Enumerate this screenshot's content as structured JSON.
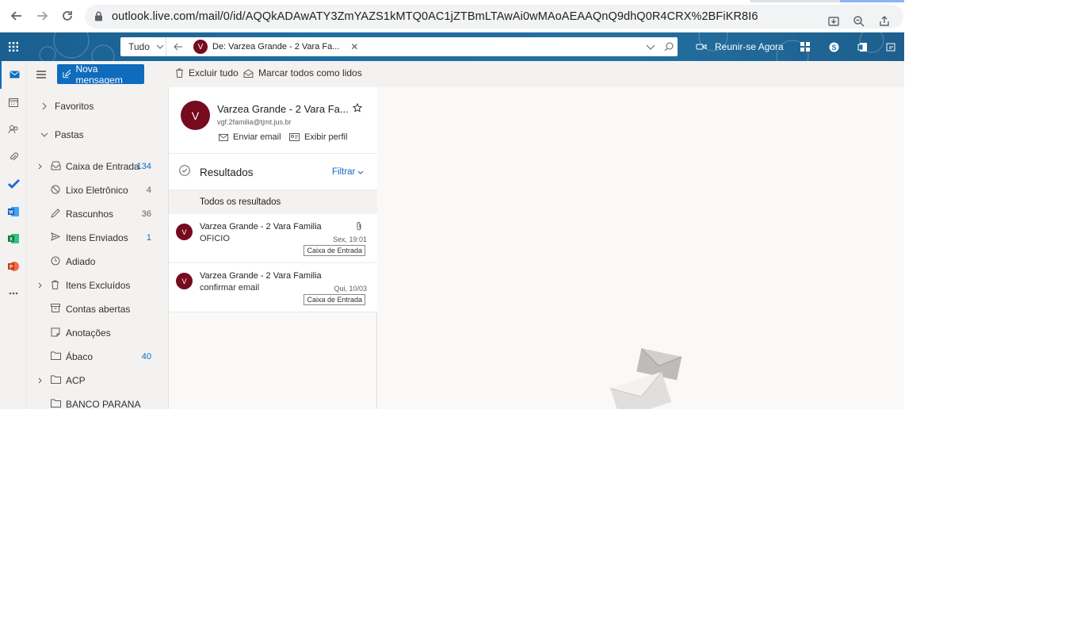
{
  "browser": {
    "url": "outlook.live.com/mail/0/id/AQQkADAwATY3ZmYAZS1kMTQ0AC1jZTBmLTAwAi0wMAoAEAAQnQ9dhQ0R4CRX%2BFiKR8I6"
  },
  "header": {
    "scope": "Tudo",
    "chip_avatar": "V",
    "chip_text": "De: Varzea Grande - 2 Vara Fa...",
    "meet_label": "Reunir-se Agora"
  },
  "commands": {
    "new_message": "Nova mensagem",
    "delete_all": "Excluir tudo",
    "mark_all_read": "Marcar todos como lidos"
  },
  "folders": {
    "favorites": "Favoritos",
    "folders_header": "Pastas",
    "items": [
      {
        "label": "Caixa de Entrada",
        "count": "134"
      },
      {
        "label": "Lixo Eletrônico",
        "count": "4"
      },
      {
        "label": "Rascunhos",
        "count": "36"
      },
      {
        "label": "Itens Enviados",
        "count": "1"
      },
      {
        "label": "Adiado",
        "count": ""
      },
      {
        "label": "Itens Excluídos",
        "count": ""
      },
      {
        "label": "Contas abertas",
        "count": ""
      },
      {
        "label": "Anotações",
        "count": ""
      },
      {
        "label": "Ábaco",
        "count": "40"
      },
      {
        "label": "ACP",
        "count": ""
      },
      {
        "label": "BANCO PARANA",
        "count": ""
      }
    ]
  },
  "contact": {
    "avatar": "V",
    "name": "Varzea Grande - 2 Vara Fa...",
    "email": "vgf.2familia@tjmt.jus.br",
    "send_email": "Enviar email",
    "view_profile": "Exibir perfil"
  },
  "results": {
    "title": "Resultados",
    "filter": "Filtrar",
    "all_results": "Todos os resultados"
  },
  "messages": [
    {
      "avatar": "V",
      "from": "Varzea Grande - 2 Vara Familia",
      "subject": "OFICIO",
      "date": "Sex, 19:01",
      "folder": "Caixa de Entrada"
    },
    {
      "avatar": "V",
      "from": "Varzea Grande - 2 Vara Familia",
      "subject": "confirmar email",
      "date": "Qui, 10/03",
      "folder": "Caixa de Entrada"
    }
  ],
  "colors": {
    "accent": "#0f6cbd",
    "header_bg": "#1f6ea3",
    "avatar": "#750b1c"
  }
}
